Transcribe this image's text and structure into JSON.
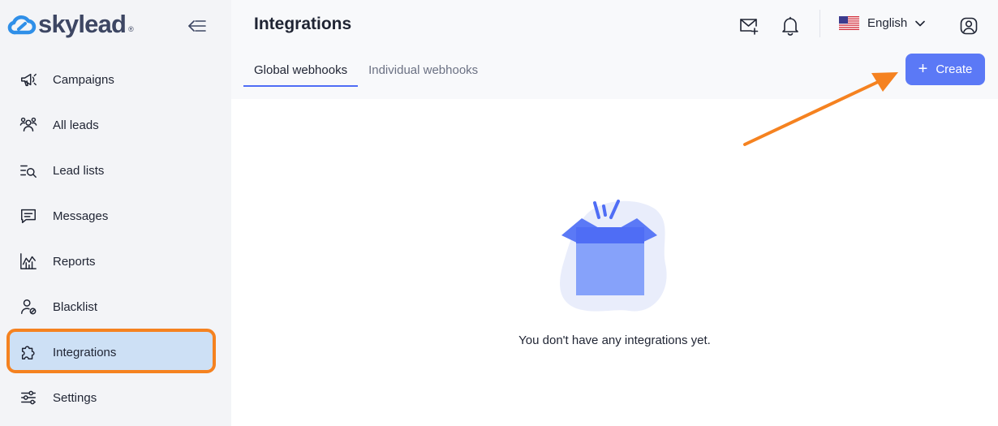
{
  "brand": {
    "name": "skylead",
    "registered": "®"
  },
  "sidebar": {
    "items": [
      {
        "label": "Campaigns",
        "icon": "megaphone-icon"
      },
      {
        "label": "All leads",
        "icon": "users-icon"
      },
      {
        "label": "Lead lists",
        "icon": "list-search-icon"
      },
      {
        "label": "Messages",
        "icon": "message-icon"
      },
      {
        "label": "Reports",
        "icon": "chart-icon"
      },
      {
        "label": "Blacklist",
        "icon": "user-block-icon"
      },
      {
        "label": "Integrations",
        "icon": "puzzle-icon",
        "active": true
      },
      {
        "label": "Settings",
        "icon": "sliders-icon"
      }
    ]
  },
  "header": {
    "title": "Integrations",
    "language": "English"
  },
  "tabs": [
    {
      "label": "Global webhooks",
      "active": true
    },
    {
      "label": "Individual webhooks",
      "active": false
    }
  ],
  "actions": {
    "create_label": "Create",
    "create_icon": "plus-icon"
  },
  "empty_state": {
    "message": "You don't have any integrations yet."
  },
  "colors": {
    "accent": "#5b79f6",
    "highlight": "#f58220",
    "active_nav": "#cde0f5",
    "brand_icon": "#2f8fe8"
  }
}
